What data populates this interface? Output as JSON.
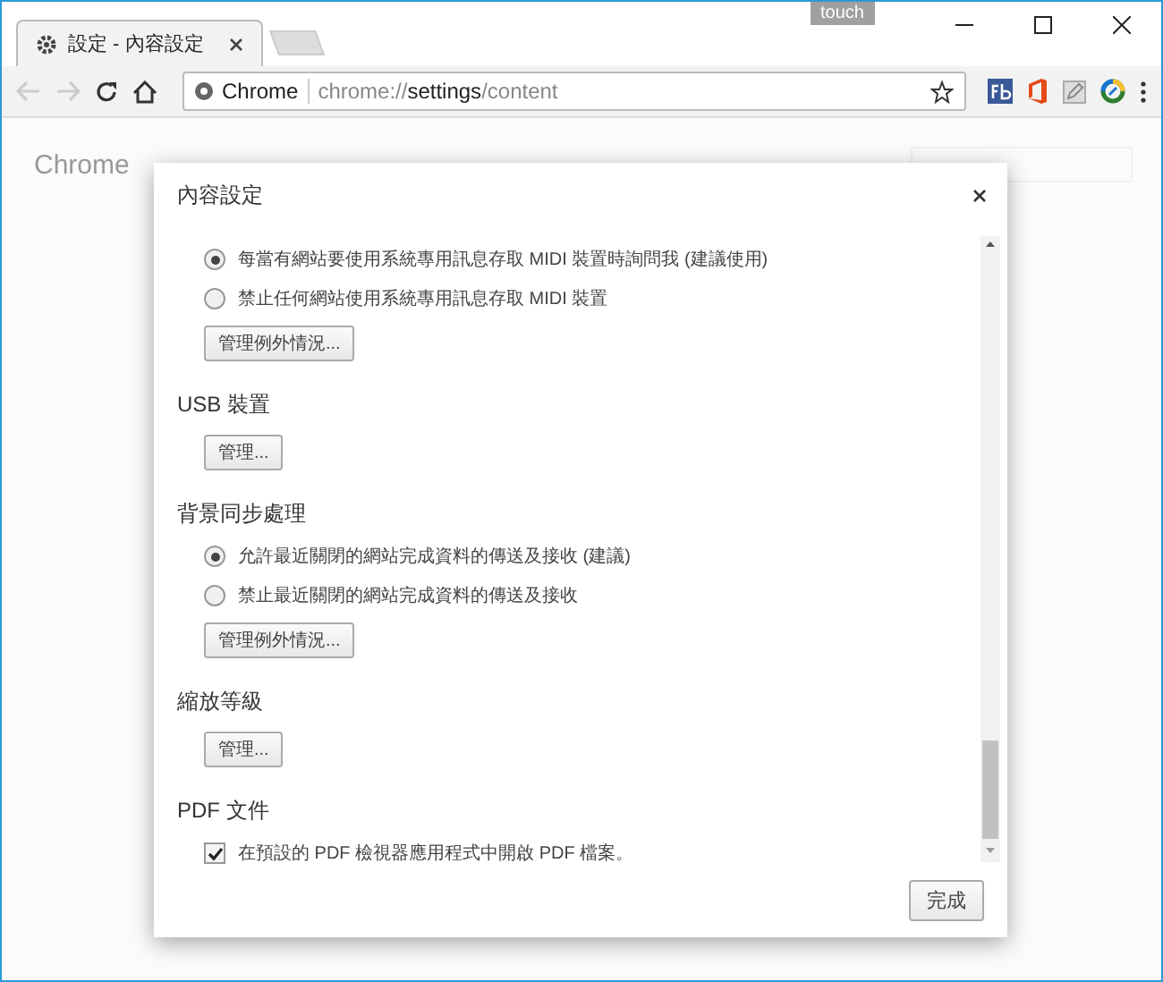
{
  "window": {
    "tab_title": "設定 - 內容設定",
    "badge": "touch"
  },
  "toolbar": {
    "site_label": "Chrome",
    "url_scheme": "chrome://",
    "url_host": "settings",
    "url_path": "/content"
  },
  "background": {
    "app_title": "Chrome"
  },
  "dialog": {
    "title": "內容設定",
    "sections": [
      {
        "items": [
          {
            "kind": "radio",
            "label": "每當有網站要使用系統專用訊息存取 MIDI 裝置時詢問我 (建議使用)",
            "selected": true
          },
          {
            "kind": "radio",
            "label": "禁止任何網站使用系統專用訊息存取 MIDI 裝置",
            "selected": false
          }
        ],
        "button": "管理例外情況..."
      },
      {
        "heading": "USB 裝置",
        "button": "管理..."
      },
      {
        "heading": "背景同步處理",
        "items": [
          {
            "kind": "radio",
            "label": "允許最近關閉的網站完成資料的傳送及接收 (建議)",
            "selected": true
          },
          {
            "kind": "radio",
            "label": "禁止最近關閉的網站完成資料的傳送及接收",
            "selected": false
          }
        ],
        "button": "管理例外情況..."
      },
      {
        "heading": "縮放等級",
        "button": "管理..."
      },
      {
        "heading": "PDF 文件",
        "items": [
          {
            "kind": "checkbox",
            "label": "在預設的 PDF 檢視器應用程式中開啟 PDF 檔案。",
            "checked": true
          }
        ]
      }
    ],
    "done_button": "完成"
  }
}
